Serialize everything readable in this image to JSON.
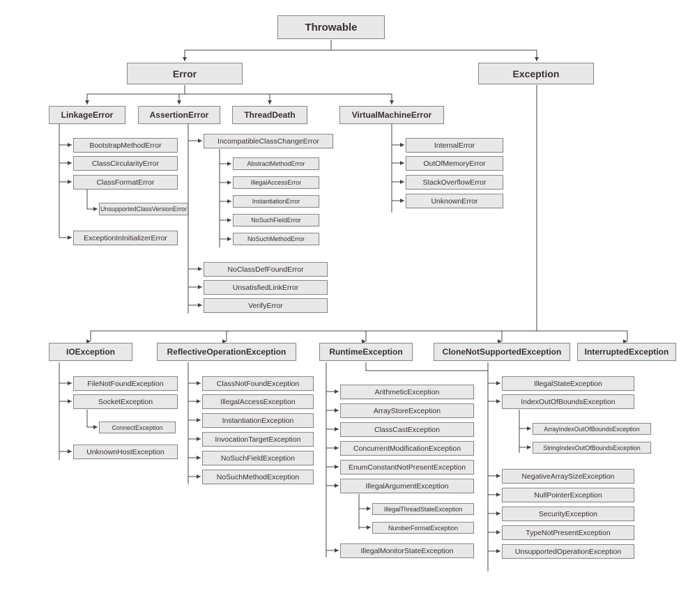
{
  "diagram": {
    "root": "Throwable",
    "error": "Error",
    "exception": "Exception",
    "linkageError": "LinkageError",
    "assertionError": "AssertionError",
    "threadDeath": "ThreadDeath",
    "virtualMachineError": "VirtualMachineError",
    "bootstrapMethodError": "BootstrapMethodError",
    "classCircularityError": "ClassCircularityError",
    "classFormatError": "ClassFormatError",
    "unsupportedClassVersionError": "UnsupportedClassVersionError",
    "exceptionInInitializerError": "ExceptionInInitializerError",
    "incompatibleClassChangeError": "IncompatibleClassChangeError",
    "abstractMethodError": "AbstractMethodError",
    "illegalAccessError": "IllegalAccessError",
    "instantiationError": "InstantiationError",
    "noSuchFieldError": "NoSuchFieldError",
    "noSuchMethodError": "NoSuchMethodError",
    "noClassDefFoundError": "NoClassDefFoundError",
    "unsatisfiedLinkError": "UnsatisfiedLinkError",
    "verifyError": "VerifyError",
    "internalError": "InternalError",
    "outOfMemoryError": "OutOfMemoryError",
    "stackOverflowError": "StackOverflowError",
    "unknownError": "UnknownError",
    "ioException": "IOException",
    "reflectiveOperationException": "ReflectiveOperationException",
    "runtimeException": "RuntimeException",
    "cloneNotSupportedException": "CloneNotSupportedException",
    "interruptedException": "InterruptedException",
    "fileNotFoundException": "FileNotFoundException",
    "socketException": "SocketException",
    "connectException": "ConnectException",
    "unknownHostException": "UnknownHostException",
    "classNotFoundException": "ClassNotFoundException",
    "illegalAccessException": "IllegalAccessException",
    "instantiationException": "InstantiationException",
    "invocationTargetException": "InvocationTargetException",
    "noSuchFieldException": "NoSuchFieldException",
    "noSuchMethodException": "NoSuchMethodException",
    "arithmeticException": "ArithmeticException",
    "arrayStoreException": "ArrayStoreException",
    "classCastException": "ClassCastException",
    "concurrentModificationException": "ConcurrentModificationException",
    "enumConstantNotPresentException": "EnumConstantNotPresentException",
    "illegalArgumentException": "IllegalArgumentException",
    "illegalThreadStateException": "IllegalThreadStateException",
    "numberFormatException": "NumberFormatException",
    "illegalMonitorStateException": "IllegalMonitorStateException",
    "illegalStateException": "IllegalStateException",
    "indexOutOfBoundsException": "IndexOutOfBoundsException",
    "arrayIndexOutOfBoundsException": "ArrayIndexOutOfBoundsException",
    "stringIndexOutOfBoundsException": "StringIndexOutOfBoundsException",
    "negativeArraySizeException": "NegativeArraySizeException",
    "nullPointerException": "NullPointerException",
    "securityException": "SecurityException",
    "typeNotPresentException": "TypeNotPresentException",
    "unsupportedOperationException": "UnsupportedOperationException"
  }
}
